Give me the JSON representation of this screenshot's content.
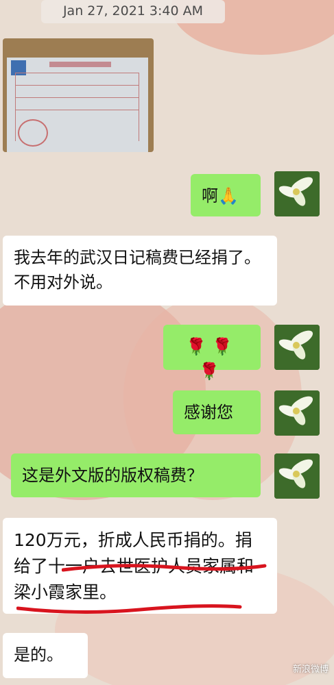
{
  "timestamp": "Jan 27, 2021 3:40 AM",
  "messages": [
    {
      "side": "right",
      "text": "啊🙏"
    },
    {
      "side": "left",
      "text": "我去年的武汉日记稿费已经捐了。不用对外说。"
    },
    {
      "side": "right",
      "text": "🌹🌹🌹"
    },
    {
      "side": "right",
      "text": "感谢您"
    },
    {
      "side": "right",
      "text": "这是外文版的版权稿费？"
    },
    {
      "side": "left",
      "text": "120万元，折成人民币捐的。捐给了十一户去世医护人员家属和梁小霞家里。"
    },
    {
      "side": "left",
      "text": "是的。"
    }
  ],
  "watermark": "新浪微博",
  "colors": {
    "bubble_right": "#95ec69",
    "bubble_left": "#ffffff",
    "underline": "#d8141e"
  }
}
